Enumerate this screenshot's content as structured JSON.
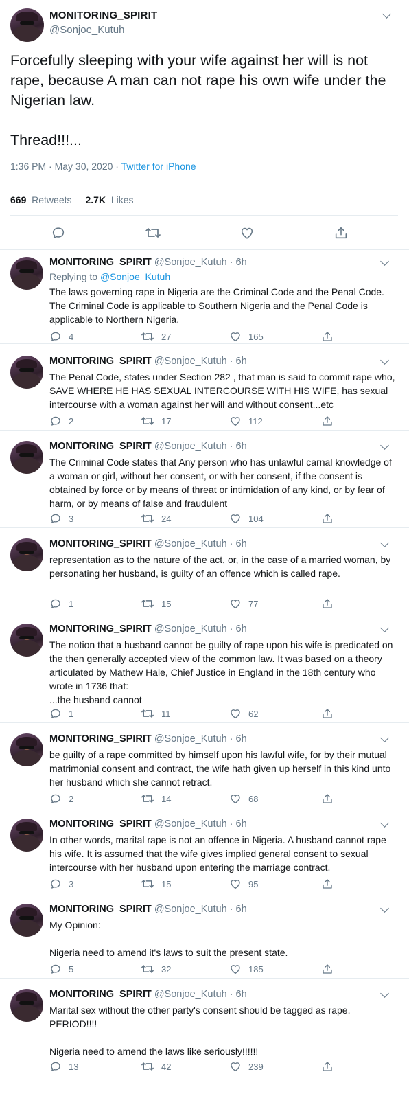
{
  "main": {
    "name": "MONITORING_SPIRIT",
    "handle": "@Sonjoe_Kutuh",
    "text": "Forcefully sleeping with your wife against her will is not rape, because A man can not rape his own wife under the Nigerian law.\n\nThread!!!...",
    "time": "1:36 PM · May 30, 2020 · ",
    "source": "Twitter for iPhone",
    "retweets_count": "669",
    "retweets_label": "Retweets",
    "likes_count": "2.7K",
    "likes_label": "Likes"
  },
  "icons": {
    "reply": "reply-icon",
    "retweet": "retweet-icon",
    "like": "heart-icon",
    "share": "share-icon",
    "more": "chevron-down-icon"
  },
  "replies": [
    {
      "name": "MONITORING_SPIRIT",
      "handle": "@Sonjoe_Kutuh · 6h",
      "replying_label": "Replying to ",
      "replying_to": "@Sonjoe_Kutuh",
      "text": "The laws governing rape in Nigeria are the Criminal Code and the Penal Code. The Criminal Code is applicable to Southern Nigeria and the Penal Code is applicable to Northern Nigeria.",
      "replies": "4",
      "retweets": "27",
      "likes": "165"
    },
    {
      "name": "MONITORING_SPIRIT",
      "handle": "@Sonjoe_Kutuh · 6h",
      "text": "The Penal Code, states under Section 282 , that man is said to commit rape who, SAVE WHERE HE HAS SEXUAL INTERCOURSE WITH HIS WIFE, has sexual intercourse with a woman against her will and without consent...etc",
      "replies": "2",
      "retweets": "17",
      "likes": "112"
    },
    {
      "name": "MONITORING_SPIRIT",
      "handle": "@Sonjoe_Kutuh · 6h",
      "text": "The Criminal Code states that Any person who has unlawful carnal knowledge of a woman or girl, without her consent, or with her consent, if the consent is obtained by force or by means of threat or intimidation of any kind, or by fear of harm, or by means of false and fraudulent",
      "replies": "3",
      "retweets": "24",
      "likes": "104"
    },
    {
      "name": "MONITORING_SPIRIT",
      "handle": "@Sonjoe_Kutuh · 6h",
      "text": "representation as to the nature of the act, or, in the case of a married woman, by personating her husband, is guilty of an offence which is called rape.",
      "replies": "1",
      "retweets": "15",
      "likes": "77"
    },
    {
      "name": "MONITORING_SPIRIT",
      "handle": "@Sonjoe_Kutuh · 6h",
      "text": "The notion that a husband cannot be guilty of rape upon his wife is predicated on the then generally accepted view of the common law. It was based on a theory articulated by Mathew Hale, Chief Justice in England in the 18th century who wrote in 1736 that:\n...the husband cannot",
      "replies": "1",
      "retweets": "11",
      "likes": "62"
    },
    {
      "name": "MONITORING_SPIRIT",
      "handle": "@Sonjoe_Kutuh · 6h",
      "text": "be guilty of a rape committed by himself upon his lawful wife, for by their mutual matrimonial consent and contract, the wife hath given up herself in this kind unto her husband which she cannot retract.",
      "replies": "2",
      "retweets": "14",
      "likes": "68"
    },
    {
      "name": "MONITORING_SPIRIT",
      "handle": "@Sonjoe_Kutuh · 6h",
      "text": "In other words, marital rape is not an offence in Nigeria. A husband cannot rape his wife. It is assumed that the wife gives implied general consent to sexual intercourse with her husband upon entering the marriage contract.",
      "replies": "3",
      "retweets": "15",
      "likes": "95"
    },
    {
      "name": "MONITORING_SPIRIT",
      "handle": "@Sonjoe_Kutuh · 6h",
      "text": "My Opinion:\n\nNigeria need to amend it's laws to suit the present state.",
      "replies": "5",
      "retweets": "32",
      "likes": "185"
    },
    {
      "name": "MONITORING_SPIRIT",
      "handle": "@Sonjoe_Kutuh · 6h",
      "text": "Marital sex without the other party's consent should be tagged as rape. PERIOD!!!!\n\nNigeria need to amend the laws like seriously!!!!!!",
      "replies": "13",
      "retweets": "42",
      "likes": "239"
    }
  ]
}
